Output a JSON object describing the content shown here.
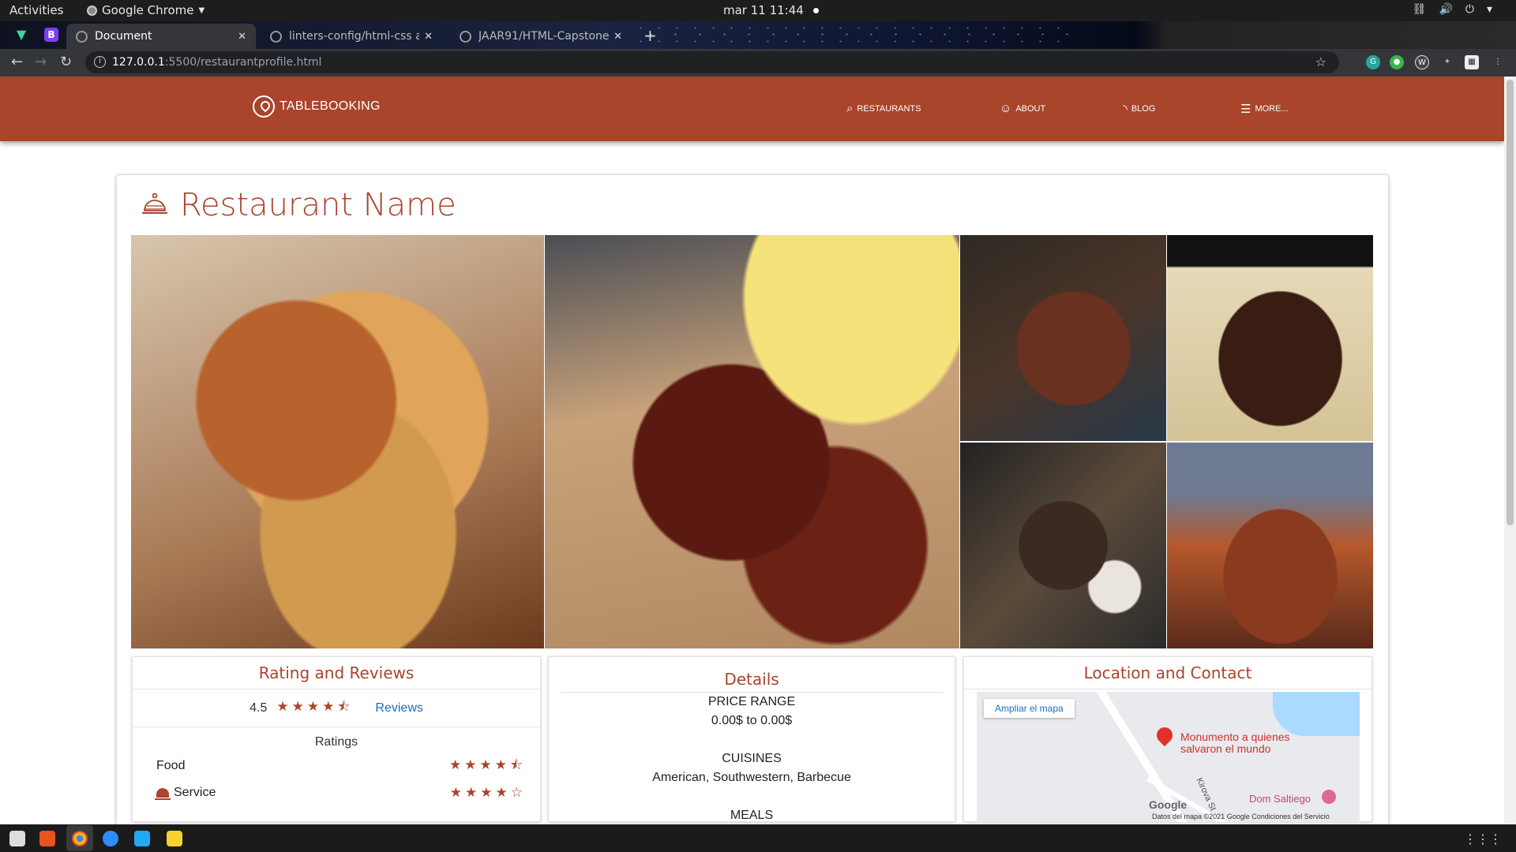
{
  "os": {
    "activities": "Activities",
    "app_name": "Google Chrome",
    "clock": "mar 11  11:44"
  },
  "browser": {
    "tabs": [
      {
        "label": "Document",
        "active": true
      },
      {
        "label": "linters-config/html-css at",
        "active": false
      },
      {
        "label": "JAAR91/HTML-Capstone",
        "active": false
      }
    ],
    "url_host": "127.0.0.1",
    "url_path": ":5500/restaurantprofile.html"
  },
  "site": {
    "brand": "TABLEBOOKING",
    "nav": [
      {
        "label": "RESTAURANTS",
        "icon": "search-icon"
      },
      {
        "label": "ABOUT",
        "icon": "user-icon"
      },
      {
        "label": "BLOG",
        "icon": "rss-icon"
      },
      {
        "label": "MORE...",
        "icon": "menu-icon"
      }
    ],
    "accent_color": "#a8452b"
  },
  "restaurant": {
    "name": "Restaurant Name",
    "gallery": [
      "pulled pork sandwich with beans",
      "bbq ribs with corn",
      "sliced ribs",
      "sliced brisket",
      "bbq platter",
      "meat platter with fries"
    ]
  },
  "ratings": {
    "heading": "Rating and Reviews",
    "score": "4.5",
    "score_value": 4.5,
    "reviews_link": "Reviews",
    "subheading": "Ratings",
    "criteria": [
      {
        "label": "Food",
        "value": 4.5
      },
      {
        "label": "Service",
        "value": 4
      }
    ]
  },
  "details": {
    "heading": "Details",
    "price_label": "PRICE RANGE",
    "price_value": "0.00$ to 0.00$",
    "cuisines_label": "CUISINES",
    "cuisines_value": "American, Southwestern, Barbecue",
    "meals_label": "MEALS"
  },
  "location": {
    "heading": "Location and Contact",
    "map_button": "Ampliar el mapa",
    "marker_label": "Monumento a quienes salvaron el mundo",
    "poi_label": "Dom Saltiego",
    "street_label": "Kirova St",
    "google_logo": "Google",
    "attribution": "Datos del mapa ©2021 Google    Condiciones del Servicio"
  }
}
